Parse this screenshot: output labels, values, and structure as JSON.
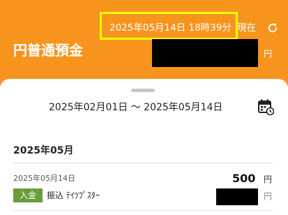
{
  "header": {
    "timestamp": "2025年05月14日 18時39分",
    "as_of_label": "現在",
    "refresh_icon": "refresh-icon",
    "account_name": "円普通預金",
    "currency": "円",
    "background_color": "#f7941d",
    "highlight_color": "#ffff00"
  },
  "filter": {
    "date_range": "2025年02月01日 ～ 2025年05月14日",
    "calendar_icon": "calendar-icon"
  },
  "transactions": {
    "month_label": "2025年05月",
    "items": [
      {
        "date": "2025年05月14日",
        "amount": "500",
        "currency": "円",
        "type_badge": "入金",
        "description": "振込 ﾃｲﾂﾌﾟｽﾀｰ",
        "balance_currency": "円"
      }
    ],
    "badge_color": "#6a9c3c"
  }
}
